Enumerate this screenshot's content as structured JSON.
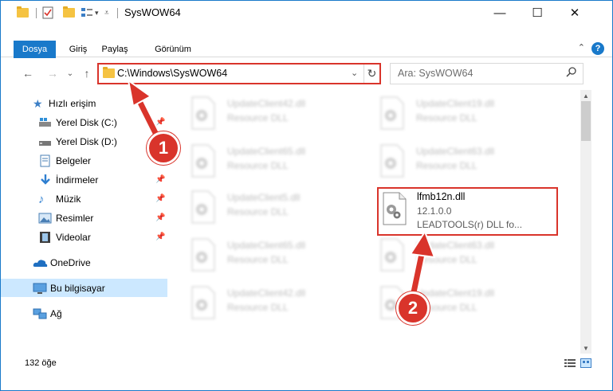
{
  "window": {
    "title": "SysWOW64",
    "minimize_glyph": "—",
    "maximize_glyph": "☐",
    "close_glyph": "✕"
  },
  "ribbon": {
    "tabs": [
      "Dosya",
      "Giriş",
      "Paylaş",
      "Görünüm"
    ],
    "help_glyph": "?",
    "collapse_glyph": "⌃"
  },
  "nav": {
    "back_glyph": "←",
    "forward_glyph": "→",
    "recent_glyph": "⌄",
    "up_glyph": "↑"
  },
  "address": {
    "path": "C:\\Windows\\SysWOW64",
    "dropdown_glyph": "⌄",
    "refresh_glyph": "↻"
  },
  "search": {
    "placeholder": "Ara: SysWOW64"
  },
  "sidebar": {
    "items": [
      {
        "label": "Hızlı erişim",
        "icon": "star-icon"
      },
      {
        "label": "Yerel Disk (C:)",
        "icon": "drive-c-icon",
        "pinned": true
      },
      {
        "label": "Yerel Disk (D:)",
        "icon": "drive-d-icon",
        "pinned": false
      },
      {
        "label": "Belgeler",
        "icon": "documents-icon",
        "pinned": true
      },
      {
        "label": "İndirmeler",
        "icon": "downloads-icon",
        "pinned": true
      },
      {
        "label": "Müzik",
        "icon": "music-icon",
        "pinned": true
      },
      {
        "label": "Resimler",
        "icon": "pictures-icon",
        "pinned": true
      },
      {
        "label": "Videolar",
        "icon": "videos-icon",
        "pinned": true
      },
      {
        "label": "OneDrive",
        "icon": "onedrive-icon"
      },
      {
        "label": "Bu bilgisayar",
        "icon": "this-pc-icon",
        "selected": true
      },
      {
        "label": "Ağ",
        "icon": "network-icon"
      }
    ],
    "pin_glyph": "📌"
  },
  "files": [
    {
      "name": "UpdateClient42.dll",
      "desc": "Resource DLL"
    },
    {
      "name": "UpdateClient19.dll",
      "desc": "Resource DLL"
    },
    {
      "name": "UpdateClient65.dll",
      "desc": "Resource DLL"
    },
    {
      "name": "UpdateClient63.dll",
      "desc": "Resource DLL"
    },
    {
      "name": "UpdateClient5.dll",
      "desc": "Resource DLL"
    },
    {
      "name": "UpdateClient65.dll",
      "desc": "Resource DLL"
    },
    {
      "name": "UpdateClient63.dll",
      "desc": "Resource DLL"
    },
    {
      "name": "UpdateClient42.dll",
      "desc": "Resource DLL"
    },
    {
      "name": "UpdateClient19.dll",
      "desc": "Resource DLL"
    }
  ],
  "target_file": {
    "name": "lfmb12n.dll",
    "version": "12.1.0.0",
    "description": "LEADTOOLS(r) DLL fo..."
  },
  "status": {
    "item_count": "132 öğe"
  },
  "callouts": {
    "step1": "1",
    "step2": "2",
    "color": "#d9342b"
  },
  "colors": {
    "accent": "#1979ca",
    "selected": "#cce8ff",
    "highlight": "#d9342b"
  }
}
